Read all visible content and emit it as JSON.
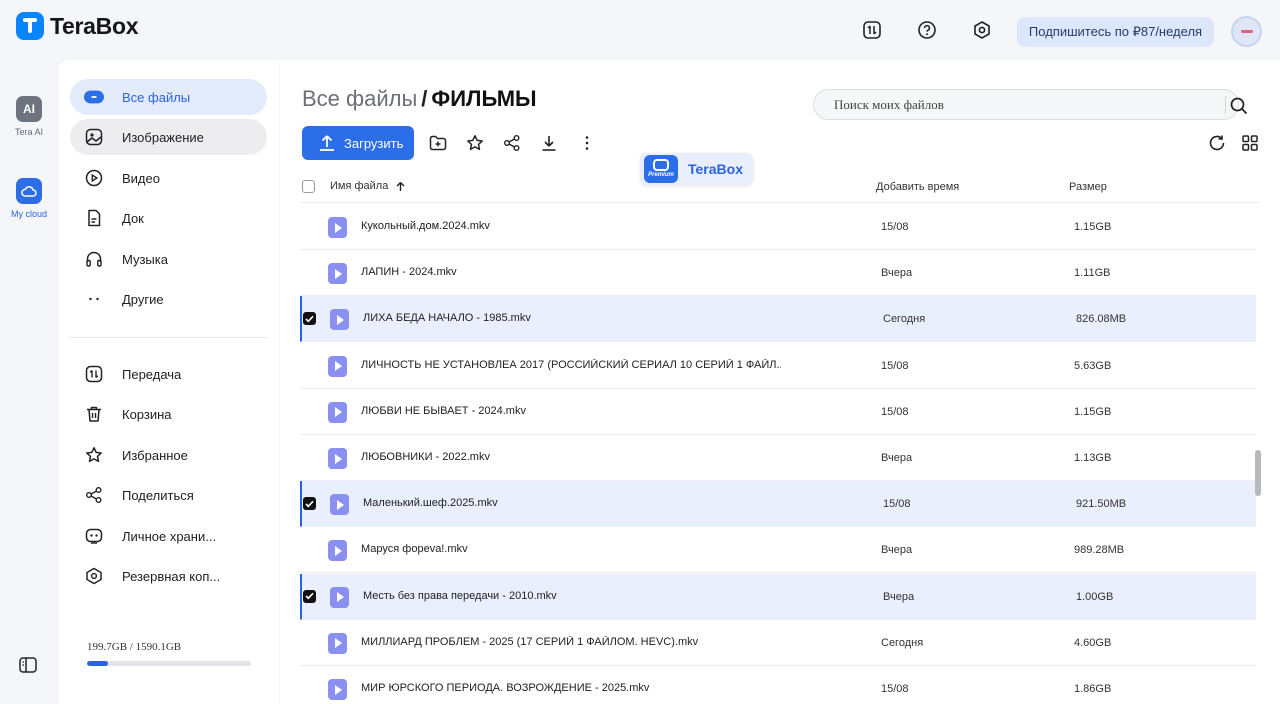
{
  "app": {
    "logo_text": "TeraBox"
  },
  "topbar": {
    "subscribe_label": "Подпишитесь по ₽87/неделя"
  },
  "rail": {
    "ai_icon_text": "AI",
    "ai_label": "Tera AI",
    "cloud_label": "My cloud"
  },
  "sidebar": {
    "items": [
      {
        "label": "Все файлы"
      },
      {
        "label": "Изображение"
      },
      {
        "label": "Видео"
      },
      {
        "label": "Док"
      },
      {
        "label": "Музыка"
      },
      {
        "label": "Другие"
      },
      {
        "label": "Передача"
      },
      {
        "label": "Корзина"
      },
      {
        "label": "Избранное"
      },
      {
        "label": "Поделиться"
      },
      {
        "label": "Личное храни..."
      },
      {
        "label": "Резервная коп..."
      }
    ],
    "storage_text": "199.7GB / 1590.1GB",
    "storage_used_fraction": 0.126
  },
  "main": {
    "breadcrumb_root": "Все файлы",
    "breadcrumb_sep": "/",
    "breadcrumb_current": "ФИЛЬМЫ",
    "search_placeholder": "Поиск моих файлов",
    "upload_label": "Загрузить",
    "premium_badge": {
      "label": "Premium",
      "text": "TeraBox"
    },
    "columns": {
      "name": "Имя файла",
      "time": "Добавить время",
      "size": "Размер"
    },
    "files": [
      {
        "name": "Кукольный.дом.2024.mkv",
        "time": "15/08",
        "size": "1.15GB",
        "selected": false
      },
      {
        "name": "ЛАПИН - 2024.mkv",
        "time": "Вчера",
        "size": "1.11GB",
        "selected": false
      },
      {
        "name": "ЛИХА БЕДА НАЧАЛО - 1985.mkv",
        "time": "Сегодня",
        "size": "826.08MB",
        "selected": true
      },
      {
        "name": "ЛИЧНОСТЬ НЕ УСТАНОВЛЕА 2017 (РОССИЙСКИЙ СЕРИАЛ 10 СЕРИЙ 1 ФАЙЛ...",
        "time": "15/08",
        "size": "5.63GB",
        "selected": false
      },
      {
        "name": "ЛЮБВИ НЕ БЫВАЕТ - 2024.mkv",
        "time": "15/08",
        "size": "1.15GB",
        "selected": false
      },
      {
        "name": "ЛЮБОВНИКИ - 2022.mkv",
        "time": "Вчера",
        "size": "1.13GB",
        "selected": false
      },
      {
        "name": "Маленький.шеф.2025.mkv",
        "time": "15/08",
        "size": "921.50MB",
        "selected": true
      },
      {
        "name": "Маруся фореva!.mkv",
        "time": "Вчера",
        "size": "989.28MB",
        "selected": false
      },
      {
        "name": "Месть без права передачи - 2010.mkv",
        "time": "Вчера",
        "size": "1.00GB",
        "selected": true
      },
      {
        "name": "МИЛЛИАРД ПРОБЛЕМ - 2025 (17 СЕРИЙ 1 ФАЙЛОМ. HEVC).mkv",
        "time": "Сегодня",
        "size": "4.60GB",
        "selected": false
      },
      {
        "name": "МИР ЮРСКОГО ПЕРИОДА. ВОЗРОЖДЕНИЕ - 2025.mkv",
        "time": "15/08",
        "size": "1.86GB",
        "selected": false
      }
    ]
  },
  "colors": {
    "accent": "#2b6ee8",
    "selected_row": "#e9effc",
    "file_icon": "#8a90f0"
  }
}
